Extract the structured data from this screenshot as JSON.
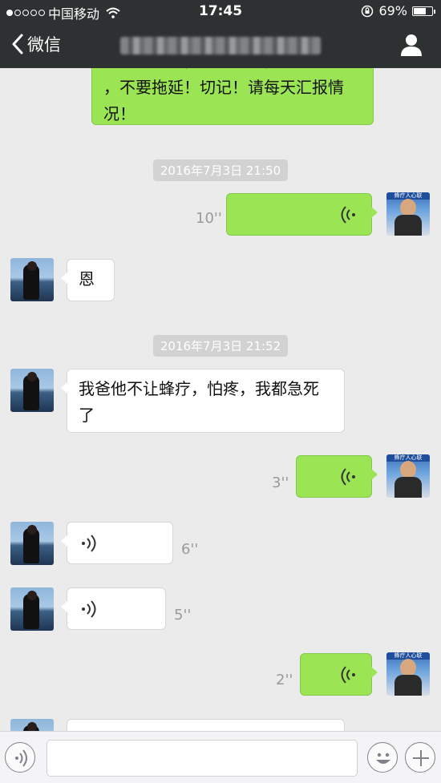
{
  "status_bar": {
    "carrier": "中国移动",
    "time": "17:45",
    "battery_percent": "69%",
    "battery_level": 0.69,
    "signal_dots_filled": 1
  },
  "nav": {
    "back_label": "微信",
    "title": "████████ ███████"
  },
  "messages": [
    {
      "type": "text",
      "side": "me",
      "text": "，不要拖延！切记！请每天汇报情况！",
      "partial_top": true
    },
    {
      "type": "timestamp",
      "text": "2016年7月3日 21:50"
    },
    {
      "type": "voice",
      "side": "me",
      "duration": "10''"
    },
    {
      "type": "text",
      "side": "them",
      "text": "恩"
    },
    {
      "type": "timestamp",
      "text": "2016年7月3日 21:52"
    },
    {
      "type": "text",
      "side": "them",
      "text": "我爸他不让蜂疗，怕疼，我都急死了"
    },
    {
      "type": "voice",
      "side": "me",
      "duration": "3''"
    },
    {
      "type": "voice",
      "side": "them",
      "duration": "6''"
    },
    {
      "type": "voice",
      "side": "them",
      "duration": "5''"
    },
    {
      "type": "voice",
      "side": "me",
      "duration": "2''"
    }
  ],
  "avatar_banner_text": "蜂疗人心联",
  "input_bar": {
    "placeholder": ""
  },
  "icons": {
    "voice_toggle": "voice-mode-icon",
    "emoji": "emoji-icon",
    "more": "plus-icon"
  },
  "colors": {
    "nav_bg": "#2e3132",
    "chat_bg": "#ebebeb",
    "bubble_me": "#9be555",
    "bubble_them": "#ffffff",
    "timestamp_bg": "#d2d2d2"
  }
}
